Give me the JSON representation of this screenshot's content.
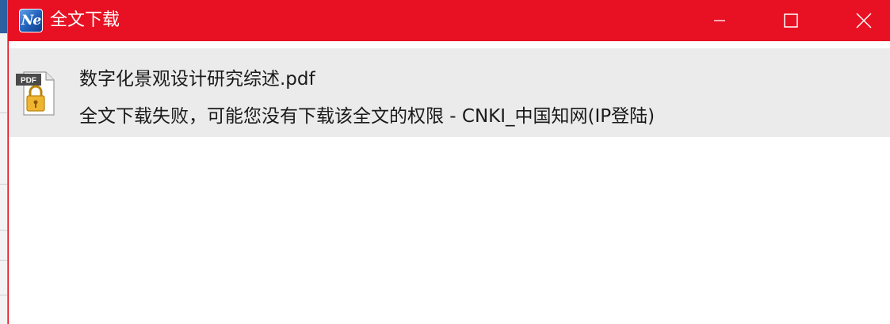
{
  "window": {
    "title": "全文下载",
    "app_icon_text": "Ne",
    "accent_color": "#e81123"
  },
  "controls": {
    "minimize_icon": "minimize-icon",
    "maximize_icon": "maximize-icon",
    "close_icon": "close-icon"
  },
  "download_item": {
    "file_icon": "locked-pdf-icon",
    "file_icon_label": "PDF",
    "file_name": "数字化景观设计研究综述.pdf",
    "status": "全文下载失败，可能您没有下载该全文的权限  -  CNKI_中国知网(IP登陆)"
  }
}
